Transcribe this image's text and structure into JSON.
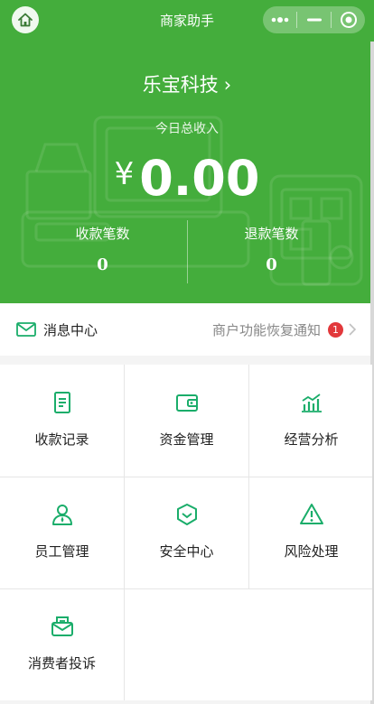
{
  "nav": {
    "title": "商家助手",
    "home_icon": "home-icon",
    "more_icon": "more-dots-icon",
    "minimize_icon": "minimize-icon",
    "close_icon": "target-close-icon"
  },
  "merchant": {
    "name": "乐宝科技",
    "chevron": "›"
  },
  "income": {
    "label": "今日总收入",
    "currency": "¥",
    "amount": "0.00"
  },
  "stats": {
    "receipts_label": "收款笔数",
    "receipts_value": "0",
    "refunds_label": "退款笔数",
    "refunds_value": "0"
  },
  "message": {
    "title": "消息中心",
    "notice": "商户功能恢复通知",
    "badge": "1"
  },
  "grid": [
    {
      "label": "收款记录",
      "icon": "receipt-record-icon"
    },
    {
      "label": "资金管理",
      "icon": "wallet-icon"
    },
    {
      "label": "经营分析",
      "icon": "bar-chart-icon"
    },
    {
      "label": "员工管理",
      "icon": "staff-icon"
    },
    {
      "label": "安全中心",
      "icon": "shield-icon"
    },
    {
      "label": "风险处理",
      "icon": "warning-icon"
    },
    {
      "label": "消费者投诉",
      "icon": "complaint-icon"
    }
  ],
  "colors": {
    "brand_green": "#44ad3c",
    "icon_green": "#1aad6a",
    "badge_red": "#e2383b"
  }
}
